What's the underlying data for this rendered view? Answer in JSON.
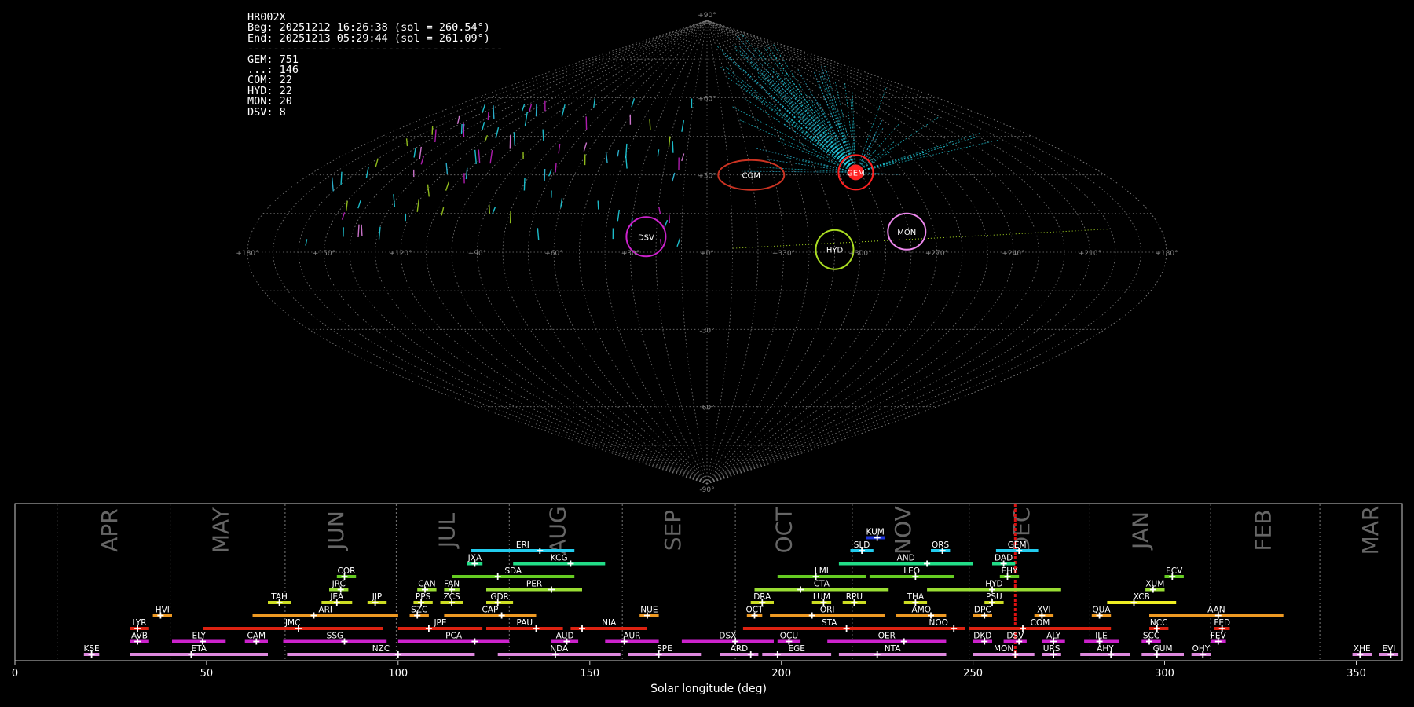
{
  "header": {
    "station": "HR002X",
    "begin": "Beg: 20251212 16:26:38 (sol = 260.54°)",
    "end": "End: 20251213 05:29:44 (sol = 261.09°)",
    "separator": "----------------------------------------",
    "counts": [
      {
        "label": "GEM",
        "value": 751
      },
      {
        "label": "...",
        "value": 146
      },
      {
        "label": "COM",
        "value": 22
      },
      {
        "label": "HYD",
        "value": 22
      },
      {
        "label": "MON",
        "value": 20
      },
      {
        "label": "DSV",
        "value": 8
      }
    ]
  },
  "chart_data": [
    {
      "type": "scatter",
      "projection": "sinusoidal sky map",
      "grid": true,
      "lon_ticks": [
        "+180°",
        "+150°",
        "+120°",
        "+90°",
        "+60°",
        "+30°",
        "+0°",
        "+330°",
        "+300°",
        "+270°",
        "+240°",
        "+210°",
        "+180°"
      ],
      "lat_ticks": [
        "+90°",
        "+60°",
        "+30°",
        "-30°",
        "-60°",
        "-90°"
      ],
      "radiants": [
        {
          "name": "COM",
          "lon": 160,
          "lat": 30,
          "color": "#cc3322"
        },
        {
          "name": "GEM",
          "lon": 112,
          "lat": 31,
          "color": "#ff2222"
        },
        {
          "name": "HYD",
          "lon": 130,
          "lat": 1,
          "color": "#aadd22"
        },
        {
          "name": "MON",
          "lon": 101,
          "lat": 8,
          "color": "#ee88ee"
        },
        {
          "name": "DSV",
          "lon": 204,
          "lat": 6,
          "color": "#cc22cc"
        }
      ]
    },
    {
      "type": "bar",
      "xlabel": "Solar longitude (deg)",
      "xlim": [
        0,
        362
      ],
      "x_ticks": [
        0,
        50,
        100,
        150,
        200,
        250,
        300,
        350
      ],
      "current_sol": 261,
      "months": [
        {
          "label": "APR",
          "center": 25,
          "boundary": 11
        },
        {
          "label": "MAY",
          "center": 54,
          "boundary": 40.5
        },
        {
          "label": "JUN",
          "center": 84,
          "boundary": 70.5
        },
        {
          "label": "JUL",
          "center": 113,
          "boundary": 99.5
        },
        {
          "label": "AUG",
          "center": 142,
          "boundary": 129
        },
        {
          "label": "SEP",
          "center": 172,
          "boundary": 158.5
        },
        {
          "label": "OCT",
          "center": 201,
          "boundary": 188
        },
        {
          "label": "NOV",
          "center": 232,
          "boundary": 218.5
        },
        {
          "label": "DEC",
          "center": 263,
          "boundary": 249
        },
        {
          "label": "JAN",
          "center": 294,
          "boundary": 280.5
        },
        {
          "label": "FEB",
          "center": 326,
          "boundary": 312
        },
        {
          "label": "MAR",
          "center": 354,
          "boundary": 340.5
        }
      ],
      "showers": [
        {
          "name": "KUM",
          "start": 222,
          "end": 227,
          "peak": 225,
          "row": 9,
          "color": "#1d33dd"
        },
        {
          "name": "ERI",
          "start": 119,
          "end": 146,
          "peak": 137,
          "row": 8,
          "color": "#22ccee"
        },
        {
          "name": "SLD",
          "start": 218,
          "end": 224,
          "peak": 221,
          "row": 8,
          "color": "#22ccee"
        },
        {
          "name": "ORS",
          "start": 239,
          "end": 244,
          "peak": 242,
          "row": 8,
          "color": "#22ccee"
        },
        {
          "name": "GEM",
          "start": 256,
          "end": 267,
          "peak": 262,
          "row": 8,
          "color": "#22ccee"
        },
        {
          "name": "JXA",
          "start": 118,
          "end": 122,
          "peak": 120,
          "row": 7,
          "color": "#22dd88"
        },
        {
          "name": "KCG",
          "start": 130,
          "end": 154,
          "peak": 145,
          "row": 7,
          "color": "#22dd88"
        },
        {
          "name": "AND",
          "start": 215,
          "end": 250,
          "peak": 238,
          "row": 7,
          "color": "#22dd88"
        },
        {
          "name": "DAD",
          "start": 255,
          "end": 261,
          "peak": 258,
          "row": 7,
          "color": "#22dd88"
        },
        {
          "name": "COR",
          "start": 84,
          "end": 89,
          "peak": 86,
          "row": 6,
          "color": "#66cc22"
        },
        {
          "name": "SDA",
          "start": 114,
          "end": 146,
          "peak": 126,
          "row": 6,
          "color": "#66cc22"
        },
        {
          "name": "LMI",
          "start": 199,
          "end": 222,
          "peak": 209,
          "row": 6,
          "color": "#66cc22"
        },
        {
          "name": "LEO",
          "start": 223,
          "end": 245,
          "peak": 235,
          "row": 6,
          "color": "#66cc22"
        },
        {
          "name": "EHY",
          "start": 257,
          "end": 262,
          "peak": 259,
          "row": 6,
          "color": "#66cc22"
        },
        {
          "name": "ECV",
          "start": 300,
          "end": 305,
          "peak": 302,
          "row": 6,
          "color": "#66cc22"
        },
        {
          "name": "JRC",
          "start": 82,
          "end": 87,
          "peak": 85,
          "row": 5,
          "color": "#99dd33"
        },
        {
          "name": "CAN",
          "start": 105,
          "end": 110,
          "peak": 107,
          "row": 5,
          "color": "#99dd33"
        },
        {
          "name": "FAN",
          "start": 112,
          "end": 116,
          "peak": 114,
          "row": 5,
          "color": "#99dd33"
        },
        {
          "name": "PER",
          "start": 123,
          "end": 148,
          "peak": 140,
          "row": 5,
          "color": "#99dd33"
        },
        {
          "name": "CTA",
          "start": 193,
          "end": 228,
          "peak": 205,
          "row": 5,
          "color": "#99dd33"
        },
        {
          "name": "HYD",
          "start": 238,
          "end": 273,
          "peak": 255,
          "row": 5,
          "color": "#99dd33"
        },
        {
          "name": "XUM",
          "start": 295,
          "end": 300,
          "peak": 297,
          "row": 5,
          "color": "#99dd33"
        },
        {
          "name": "TAH",
          "start": 66,
          "end": 72,
          "peak": 69,
          "row": 4,
          "color": "#ccdd22"
        },
        {
          "name": "JEA",
          "start": 80,
          "end": 88,
          "peak": 84,
          "row": 4,
          "color": "#ccdd22"
        },
        {
          "name": "JIP",
          "start": 92,
          "end": 97,
          "peak": 94,
          "row": 4,
          "color": "#ccdd22"
        },
        {
          "name": "PPS",
          "start": 104,
          "end": 109,
          "peak": 106,
          "row": 4,
          "color": "#ccdd22"
        },
        {
          "name": "ZCS",
          "start": 111,
          "end": 117,
          "peak": 114,
          "row": 4,
          "color": "#ccdd22"
        },
        {
          "name": "GDR",
          "start": 123,
          "end": 130,
          "peak": 126,
          "row": 4,
          "color": "#ccdd22"
        },
        {
          "name": "DRA",
          "start": 192,
          "end": 198,
          "peak": 195,
          "row": 4,
          "color": "#ccdd22"
        },
        {
          "name": "LUM",
          "start": 208,
          "end": 213,
          "peak": 211,
          "row": 4,
          "color": "#ccdd22"
        },
        {
          "name": "RPU",
          "start": 216,
          "end": 222,
          "peak": 219,
          "row": 4,
          "color": "#ccdd22"
        },
        {
          "name": "THA",
          "start": 232,
          "end": 238,
          "peak": 235,
          "row": 4,
          "color": "#ccdd22"
        },
        {
          "name": "PSU",
          "start": 253,
          "end": 258,
          "peak": 255,
          "row": 4,
          "color": "#ccdd22"
        },
        {
          "name": "XCB",
          "start": 285,
          "end": 303,
          "peak": 292,
          "row": 4,
          "color": "#eeee22"
        },
        {
          "name": "HVI",
          "start": 36,
          "end": 41,
          "peak": 38,
          "row": 3,
          "color": "#ee9922"
        },
        {
          "name": "ARI",
          "start": 62,
          "end": 100,
          "peak": 78,
          "row": 3,
          "color": "#ee9922"
        },
        {
          "name": "SZC",
          "start": 103,
          "end": 108,
          "peak": 105,
          "row": 3,
          "color": "#ee9922"
        },
        {
          "name": "CAP",
          "start": 112,
          "end": 136,
          "peak": 127,
          "row": 3,
          "color": "#ee9922"
        },
        {
          "name": "NUE",
          "start": 163,
          "end": 168,
          "peak": 165,
          "row": 3,
          "color": "#ee9922"
        },
        {
          "name": "OCT",
          "start": 191,
          "end": 195,
          "peak": 193,
          "row": 3,
          "color": "#ee9922"
        },
        {
          "name": "ORI",
          "start": 197,
          "end": 227,
          "peak": 208,
          "row": 3,
          "color": "#ee9922"
        },
        {
          "name": "AMO",
          "start": 230,
          "end": 243,
          "peak": 239,
          "row": 3,
          "color": "#ee9922"
        },
        {
          "name": "DPC",
          "start": 250,
          "end": 255,
          "peak": 253,
          "row": 3,
          "color": "#ee9922"
        },
        {
          "name": "XVI",
          "start": 266,
          "end": 271,
          "peak": 268,
          "row": 3,
          "color": "#ee9922"
        },
        {
          "name": "QUA",
          "start": 281,
          "end": 286,
          "peak": 283,
          "row": 3,
          "color": "#ee9922"
        },
        {
          "name": "AAN",
          "start": 296,
          "end": 331,
          "peak": 314,
          "row": 3,
          "color": "#ee9922"
        },
        {
          "name": "LYR",
          "start": 30,
          "end": 35,
          "peak": 32,
          "row": 2,
          "color": "#dd2211"
        },
        {
          "name": "JMC",
          "start": 49,
          "end": 96,
          "peak": 74,
          "row": 2,
          "color": "#dd2211"
        },
        {
          "name": "JPE",
          "start": 100,
          "end": 122,
          "peak": 108,
          "row": 2,
          "color": "#dd2211"
        },
        {
          "name": "PAU",
          "start": 123,
          "end": 143,
          "peak": 136,
          "row": 2,
          "color": "#dd2211"
        },
        {
          "name": "NIA",
          "start": 145,
          "end": 165,
          "peak": 148,
          "row": 2,
          "color": "#dd2211"
        },
        {
          "name": "STA",
          "start": 190,
          "end": 235,
          "peak": 217,
          "row": 2,
          "color": "#dd2211"
        },
        {
          "name": "NOO",
          "start": 234,
          "end": 248,
          "peak": 245,
          "row": 2,
          "color": "#dd2211"
        },
        {
          "name": "COM",
          "start": 249,
          "end": 286,
          "peak": 263,
          "row": 2,
          "color": "#dd2211"
        },
        {
          "name": "NCC",
          "start": 296,
          "end": 301,
          "peak": 298,
          "row": 2,
          "color": "#dd2211"
        },
        {
          "name": "FED",
          "start": 313,
          "end": 317,
          "peak": 315,
          "row": 2,
          "color": "#dd2211"
        },
        {
          "name": "AVB",
          "start": 30,
          "end": 35,
          "peak": 32,
          "row": 1,
          "color": "#cc22cc"
        },
        {
          "name": "ELY",
          "start": 41,
          "end": 55,
          "peak": 49,
          "row": 1,
          "color": "#cc22cc"
        },
        {
          "name": "CAM",
          "start": 60,
          "end": 66,
          "peak": 63,
          "row": 1,
          "color": "#cc22cc"
        },
        {
          "name": "SSG",
          "start": 70,
          "end": 97,
          "peak": 86,
          "row": 1,
          "color": "#cc22cc"
        },
        {
          "name": "PCA",
          "start": 100,
          "end": 129,
          "peak": 120,
          "row": 1,
          "color": "#cc22cc"
        },
        {
          "name": "AUD",
          "start": 140,
          "end": 147,
          "peak": 144,
          "row": 1,
          "color": "#cc22cc"
        },
        {
          "name": "AUR",
          "start": 154,
          "end": 168,
          "peak": 159,
          "row": 1,
          "color": "#cc22cc"
        },
        {
          "name": "DSX",
          "start": 174,
          "end": 198,
          "peak": 188,
          "row": 1,
          "color": "#cc22cc"
        },
        {
          "name": "OCU",
          "start": 199,
          "end": 205,
          "peak": 202,
          "row": 1,
          "color": "#cc22cc"
        },
        {
          "name": "OER",
          "start": 212,
          "end": 243,
          "peak": 232,
          "row": 1,
          "color": "#cc22cc"
        },
        {
          "name": "DKD",
          "start": 250,
          "end": 255,
          "peak": 253,
          "row": 1,
          "color": "#cc22cc"
        },
        {
          "name": "DSV",
          "start": 258,
          "end": 264,
          "peak": 262,
          "row": 1,
          "color": "#cc22cc"
        },
        {
          "name": "ALY",
          "start": 268,
          "end": 274,
          "peak": 271,
          "row": 1,
          "color": "#cc22cc"
        },
        {
          "name": "ILE",
          "start": 279,
          "end": 288,
          "peak": 283,
          "row": 1,
          "color": "#cc22cc"
        },
        {
          "name": "SCC",
          "start": 294,
          "end": 299,
          "peak": 296,
          "row": 1,
          "color": "#cc22cc"
        },
        {
          "name": "FEV",
          "start": 312,
          "end": 316,
          "peak": 314,
          "row": 1,
          "color": "#cc22cc"
        },
        {
          "name": "KSE",
          "start": 18,
          "end": 22,
          "peak": 20,
          "row": 0,
          "color": "#dd88dd"
        },
        {
          "name": "ETA",
          "start": 30,
          "end": 66,
          "peak": 46,
          "row": 0,
          "color": "#dd88dd"
        },
        {
          "name": "NZC",
          "start": 71,
          "end": 120,
          "peak": 100,
          "row": 0,
          "color": "#dd88dd"
        },
        {
          "name": "NDA",
          "start": 126,
          "end": 158,
          "peak": 141,
          "row": 0,
          "color": "#dd88dd"
        },
        {
          "name": "SPE",
          "start": 160,
          "end": 179,
          "peak": 168,
          "row": 0,
          "color": "#dd88dd"
        },
        {
          "name": "ARD",
          "start": 184,
          "end": 194,
          "peak": 192,
          "row": 0,
          "color": "#dd88dd"
        },
        {
          "name": "EGE",
          "start": 195,
          "end": 213,
          "peak": 199,
          "row": 0,
          "color": "#dd88dd"
        },
        {
          "name": "NTA",
          "start": 215,
          "end": 243,
          "peak": 225,
          "row": 0,
          "color": "#dd88dd"
        },
        {
          "name": "MON",
          "start": 250,
          "end": 266,
          "peak": 261,
          "row": 0,
          "color": "#dd88dd"
        },
        {
          "name": "URS",
          "start": 268,
          "end": 273,
          "peak": 271,
          "row": 0,
          "color": "#dd88dd"
        },
        {
          "name": "AHY",
          "start": 278,
          "end": 291,
          "peak": 286,
          "row": 0,
          "color": "#dd88dd"
        },
        {
          "name": "GUM",
          "start": 294,
          "end": 305,
          "peak": 298,
          "row": 0,
          "color": "#dd88dd"
        },
        {
          "name": "OHY",
          "start": 307,
          "end": 312,
          "peak": 310,
          "row": 0,
          "color": "#dd88dd"
        },
        {
          "name": "XHE",
          "start": 349,
          "end": 354,
          "peak": 351,
          "row": 0,
          "color": "#dd88dd"
        },
        {
          "name": "EVI",
          "start": 356,
          "end": 361,
          "peak": 359,
          "row": 0,
          "color": "#dd88dd"
        }
      ]
    }
  ]
}
